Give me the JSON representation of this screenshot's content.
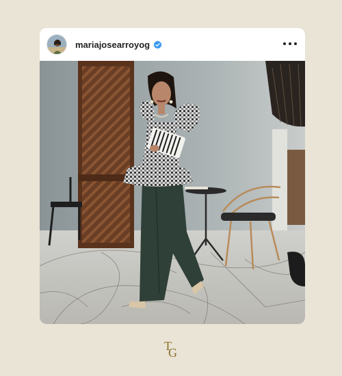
{
  "post": {
    "username": "mariajosearroyog"
  },
  "icons": {
    "avatar": "profile-avatar",
    "verified": "verified-badge-icon",
    "more": "more-options-icon",
    "logo": "brand-monogram-logo"
  },
  "colors": {
    "background": "#e9e4d6",
    "card": "#ffffff",
    "verified": "#3897f0",
    "logo": "#8c6f2a"
  },
  "brand": {
    "monogram": "TG"
  }
}
